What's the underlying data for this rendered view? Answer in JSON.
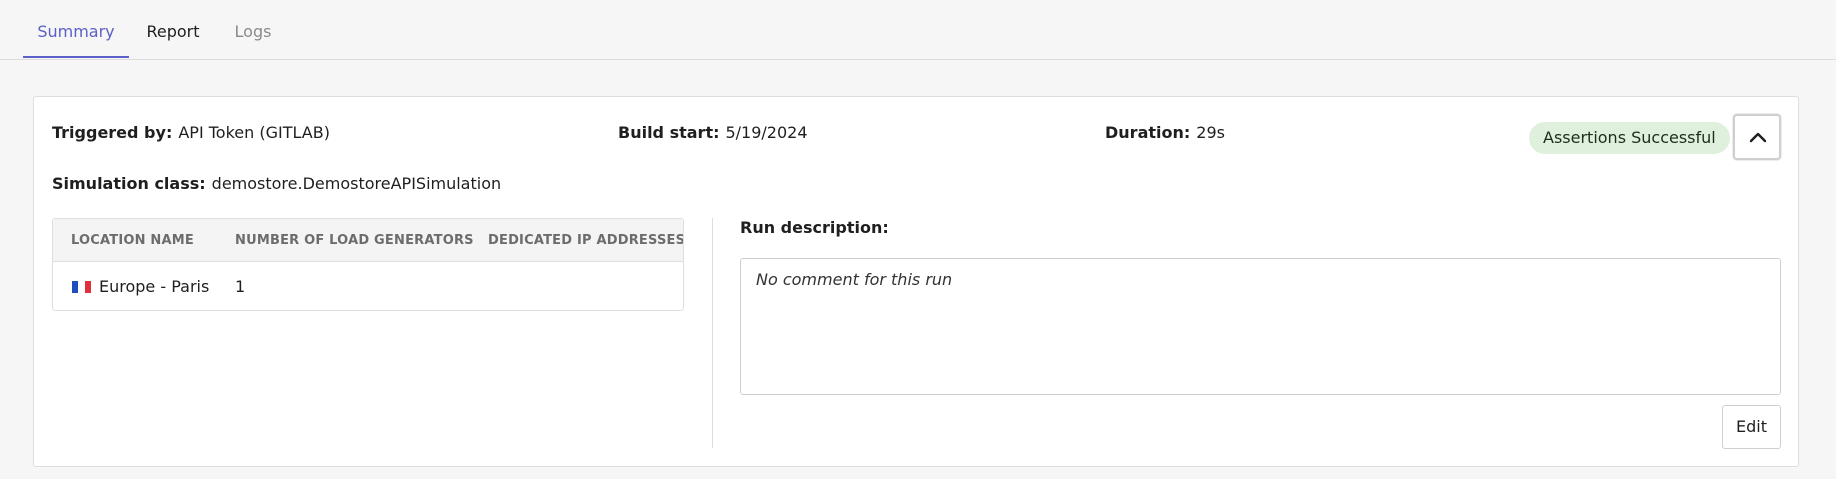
{
  "tabs": [
    {
      "label": "Summary",
      "active": true
    },
    {
      "label": "Report",
      "active": false
    },
    {
      "label": "Logs",
      "active": false
    }
  ],
  "summary": {
    "triggered_by_label": "Triggered by:",
    "triggered_by_value": "API Token (GITLAB)",
    "build_start_label": "Build start:",
    "build_start_value": "5/19/2024",
    "duration_label": "Duration:",
    "duration_value": "29s",
    "status_badge": "Assertions Successful",
    "simulation_class_label": "Simulation class:",
    "simulation_class_value": "demostore.DemostoreAPISimulation",
    "collapse_icon": "chevron-up-icon"
  },
  "locations": {
    "columns": [
      "LOCATION NAME",
      "NUMBER OF LOAD GENERATORS",
      "DEDICATED IP ADDRESSES"
    ],
    "rows": [
      {
        "flag": "france-flag-icon",
        "name": "Europe - Paris",
        "load_generators": "1",
        "dedicated_ips": ""
      }
    ]
  },
  "run": {
    "label": "Run description:",
    "description": "No comment for this run",
    "edit_label": "Edit"
  },
  "colors": {
    "accent": "#5b5fc7",
    "badge_bg": "#dff0dc"
  }
}
